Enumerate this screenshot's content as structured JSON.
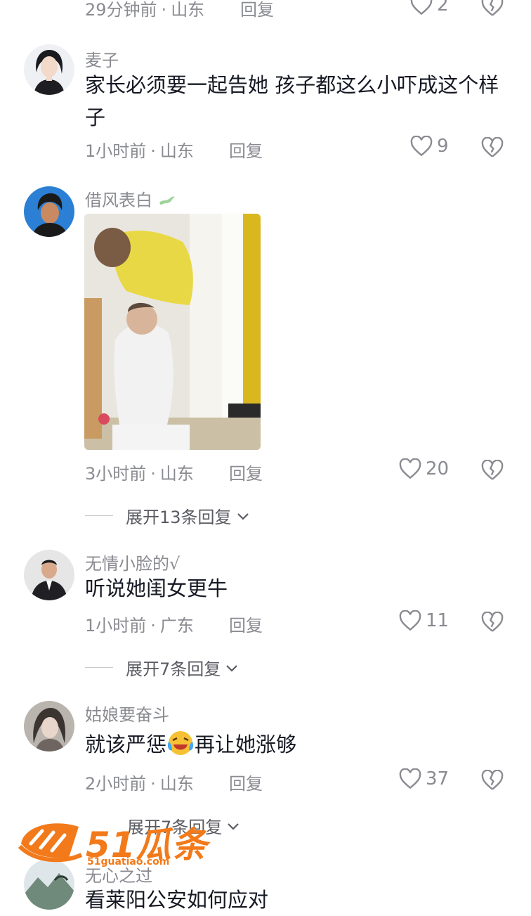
{
  "comments": [
    {
      "username": "",
      "text": "",
      "time": "29分钟前",
      "location": "山东",
      "reply": "回复",
      "likes": "2"
    },
    {
      "username": "麦子",
      "text": "家长必须要一起告她 孩子都这么小吓成这个样子",
      "time": "1小时前",
      "location": "山东",
      "reply": "回复",
      "likes": "9"
    },
    {
      "username": "借风表白",
      "text": "",
      "time": "3小时前",
      "location": "山东",
      "reply": "回复",
      "likes": "20",
      "expand": "展开13条回复"
    },
    {
      "username": "无情小脸的√",
      "text": "听说她闺女更牛",
      "time": "1小时前",
      "location": "广东",
      "reply": "回复",
      "likes": "11",
      "expand": "展开7条回复"
    },
    {
      "username": "姑娘要奋斗",
      "text_before": "就该严惩",
      "text_after": "再让她涨够",
      "time": "2小时前",
      "location": "山东",
      "reply": "回复",
      "likes": "37",
      "expand": "展开7条回复"
    },
    {
      "username": "无心之过",
      "text": "看莱阳公安如何应对"
    }
  ],
  "watermark": {
    "brand": "51瓜条",
    "url": "51guatiao.com"
  },
  "colors": {
    "text": "#161823",
    "muted": "#8a8b91",
    "accent": "#f27a1a"
  }
}
